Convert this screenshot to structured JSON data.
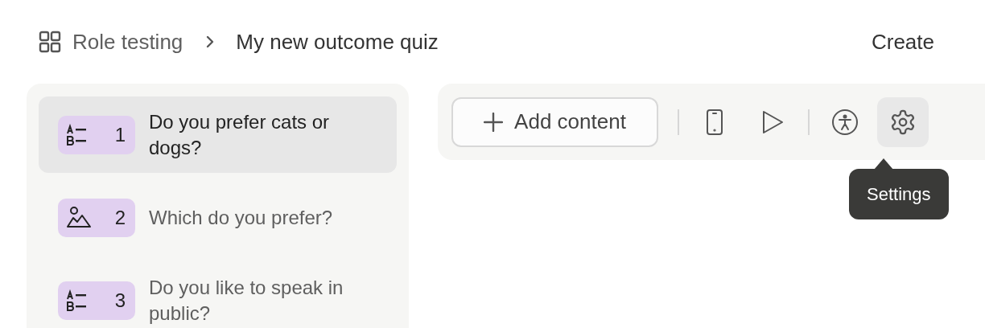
{
  "breadcrumb": {
    "parent": "Role testing",
    "current": "My new outcome quiz"
  },
  "header_actions": [
    "Create"
  ],
  "questions": [
    {
      "kind": "choice",
      "number": "1",
      "title": "Do you prefer cats or dogs?",
      "selected": true
    },
    {
      "kind": "image",
      "number": "2",
      "title": "Which do you prefer?",
      "selected": false
    },
    {
      "kind": "choice",
      "number": "3",
      "title": "Do you like to speak in public?",
      "selected": false
    }
  ],
  "toolbar": {
    "add_button": "Add content",
    "tools": [
      {
        "kind": "phone",
        "selected": false
      },
      {
        "kind": "play",
        "selected": false
      },
      {
        "kind": "separator"
      },
      {
        "kind": "accessibility",
        "selected": false
      },
      {
        "kind": "settings",
        "selected": true
      }
    ]
  },
  "tooltip": "Settings"
}
